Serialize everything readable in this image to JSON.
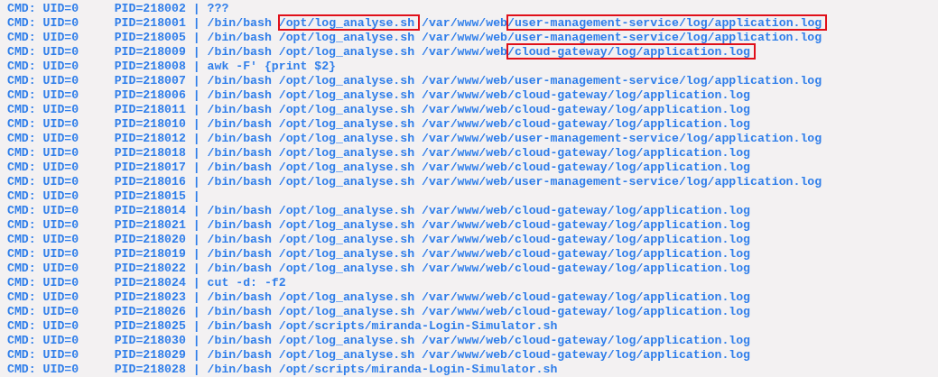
{
  "terminal": {
    "lines": [
      {
        "segments": [
          {
            "text": "CMD: UID=0     PID=218002 | ???",
            "highlighted": false
          }
        ]
      },
      {
        "segments": [
          {
            "text": "CMD: UID=0     PID=218001 | /bin/bash ",
            "highlighted": false
          },
          {
            "text": "/opt/log_analyse.sh",
            "highlighted": true
          },
          {
            "text": " /var/www/web",
            "highlighted": false
          },
          {
            "text": "/user-management-service/log/application.log",
            "highlighted": true
          }
        ]
      },
      {
        "segments": [
          {
            "text": "CMD: UID=0     PID=218005 | /bin/bash /opt/log_analyse.sh /var/www/web/user-management-service/log/application.log",
            "highlighted": false
          }
        ]
      },
      {
        "segments": [
          {
            "text": "CMD: UID=0     PID=218009 | /bin/bash /opt/log_analyse.sh /var/www/web",
            "highlighted": false
          },
          {
            "text": "/cloud-gateway/log/application.log",
            "highlighted": true
          }
        ]
      },
      {
        "segments": [
          {
            "text": "CMD: UID=0     PID=218008 | awk -F' {print $2}",
            "highlighted": false
          }
        ]
      },
      {
        "segments": [
          {
            "text": "CMD: UID=0     PID=218007 | /bin/bash /opt/log_analyse.sh /var/www/web/user-management-service/log/application.log",
            "highlighted": false
          }
        ]
      },
      {
        "segments": [
          {
            "text": "CMD: UID=0     PID=218006 | /bin/bash /opt/log_analyse.sh /var/www/web/cloud-gateway/log/application.log",
            "highlighted": false
          }
        ]
      },
      {
        "segments": [
          {
            "text": "CMD: UID=0     PID=218011 | /bin/bash /opt/log_analyse.sh /var/www/web/cloud-gateway/log/application.log",
            "highlighted": false
          }
        ]
      },
      {
        "segments": [
          {
            "text": "CMD: UID=0     PID=218010 | /bin/bash /opt/log_analyse.sh /var/www/web/cloud-gateway/log/application.log",
            "highlighted": false
          }
        ]
      },
      {
        "segments": [
          {
            "text": "CMD: UID=0     PID=218012 | /bin/bash /opt/log_analyse.sh /var/www/web/user-management-service/log/application.log",
            "highlighted": false
          }
        ]
      },
      {
        "segments": [
          {
            "text": "CMD: UID=0     PID=218018 | /bin/bash /opt/log_analyse.sh /var/www/web/cloud-gateway/log/application.log",
            "highlighted": false
          }
        ]
      },
      {
        "segments": [
          {
            "text": "CMD: UID=0     PID=218017 | /bin/bash /opt/log_analyse.sh /var/www/web/cloud-gateway/log/application.log",
            "highlighted": false
          }
        ]
      },
      {
        "segments": [
          {
            "text": "CMD: UID=0     PID=218016 | /bin/bash /opt/log_analyse.sh /var/www/web/user-management-service/log/application.log",
            "highlighted": false
          }
        ]
      },
      {
        "segments": [
          {
            "text": "CMD: UID=0     PID=218015 |",
            "highlighted": false
          }
        ]
      },
      {
        "segments": [
          {
            "text": "CMD: UID=0     PID=218014 | /bin/bash /opt/log_analyse.sh /var/www/web/cloud-gateway/log/application.log",
            "highlighted": false
          }
        ]
      },
      {
        "segments": [
          {
            "text": "CMD: UID=0     PID=218021 | /bin/bash /opt/log_analyse.sh /var/www/web/cloud-gateway/log/application.log",
            "highlighted": false
          }
        ]
      },
      {
        "segments": [
          {
            "text": "CMD: UID=0     PID=218020 | /bin/bash /opt/log_analyse.sh /var/www/web/cloud-gateway/log/application.log",
            "highlighted": false
          }
        ]
      },
      {
        "segments": [
          {
            "text": "CMD: UID=0     PID=218019 | /bin/bash /opt/log_analyse.sh /var/www/web/cloud-gateway/log/application.log",
            "highlighted": false
          }
        ]
      },
      {
        "segments": [
          {
            "text": "CMD: UID=0     PID=218022 | /bin/bash /opt/log_analyse.sh /var/www/web/cloud-gateway/log/application.log",
            "highlighted": false
          }
        ]
      },
      {
        "segments": [
          {
            "text": "CMD: UID=0     PID=218024 | cut -d: -f2",
            "highlighted": false
          }
        ]
      },
      {
        "segments": [
          {
            "text": "CMD: UID=0     PID=218023 | /bin/bash /opt/log_analyse.sh /var/www/web/cloud-gateway/log/application.log",
            "highlighted": false
          }
        ]
      },
      {
        "segments": [
          {
            "text": "CMD: UID=0     PID=218026 | /bin/bash /opt/log_analyse.sh /var/www/web/cloud-gateway/log/application.log",
            "highlighted": false
          }
        ]
      },
      {
        "segments": [
          {
            "text": "CMD: UID=0     PID=218025 | /bin/bash /opt/scripts/miranda-Login-Simulator.sh",
            "highlighted": false
          }
        ]
      },
      {
        "segments": [
          {
            "text": "CMD: UID=0     PID=218030 | /bin/bash /opt/log_analyse.sh /var/www/web/cloud-gateway/log/application.log",
            "highlighted": false
          }
        ]
      },
      {
        "segments": [
          {
            "text": "CMD: UID=0     PID=218029 | /bin/bash /opt/log_analyse.sh /var/www/web/cloud-gateway/log/application.log",
            "highlighted": false
          }
        ]
      },
      {
        "segments": [
          {
            "text": "CMD: UID=0     PID=218028 | /bin/bash /opt/scripts/miranda-Login-Simulator.sh",
            "highlighted": false
          }
        ]
      }
    ]
  }
}
